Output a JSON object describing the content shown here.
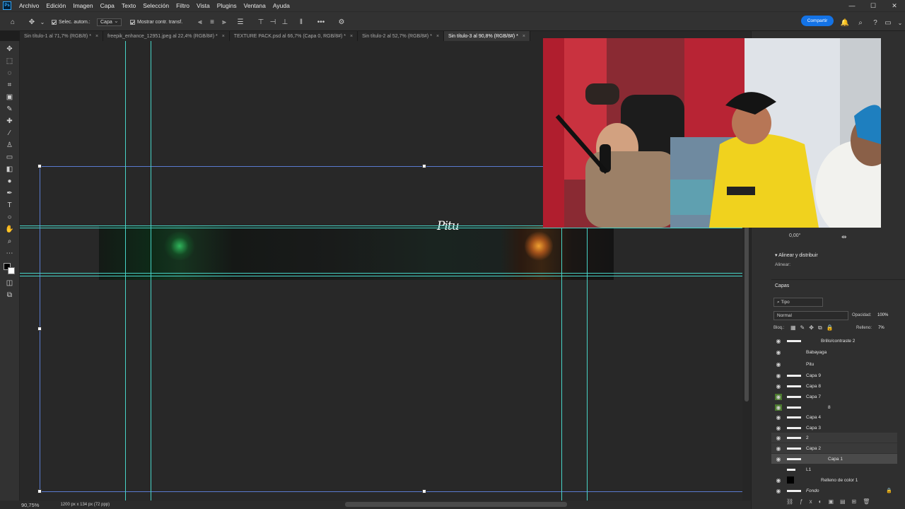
{
  "app": {
    "logo": "Ps"
  },
  "menu": [
    "Archivo",
    "Edición",
    "Imagen",
    "Capa",
    "Texto",
    "Selección",
    "Filtro",
    "Vista",
    "Plugins",
    "Ventana",
    "Ayuda"
  ],
  "window_controls": [
    "—",
    "☐",
    "✕"
  ],
  "options_bar": {
    "auto_select_label": "Selec. autom.:",
    "auto_select_value": "Capa",
    "show_transform_label": "Mostrar contr. transf.",
    "more_label": "•••",
    "share_label": "Compartir"
  },
  "tabs": [
    {
      "label": "Sin título-1 al 71,7% (RGB/8) *"
    },
    {
      "label": "freepik_enhance_12951.jpeg al 22,4% (RGB/8#) *"
    },
    {
      "label": "TEXTURE PACK.psd al 66,7% (Capa 0, RGB/8#) *"
    },
    {
      "label": "Sin título-2 al 52,7% (RGB/8#) *"
    },
    {
      "label": "Sin título-3 al 90,8% (RGB/8#) *"
    }
  ],
  "tab_close": "×",
  "canvas": {
    "text_layer": "Pitu"
  },
  "status": {
    "zoom": "90,75%",
    "doc_info": "1200 px x 134 px (72 ppp)"
  },
  "properties": {
    "angle": "0,00°"
  },
  "align_panel": {
    "title": "Alinear y distribuir",
    "label": "Alinear:"
  },
  "layers_panel": {
    "title": "Capas",
    "filter": "Tipo",
    "blend_mode": "Normal",
    "opacity_label": "Opacidad:",
    "opacity_value": "100%",
    "lock_label": "Bloq.:",
    "fill_label": "Relleno:",
    "fill_value": "7%",
    "layers": [
      {
        "name": "Brillo/contraste 2",
        "visible": true
      },
      {
        "name": "Babayaga",
        "visible": true
      },
      {
        "name": "Pitu",
        "visible": true
      },
      {
        "name": "Capa 9",
        "visible": true
      },
      {
        "name": "Capa 8",
        "visible": true
      },
      {
        "name": "Capa 7",
        "visible": true
      },
      {
        "name": "8",
        "visible": true
      },
      {
        "name": "Capa 4",
        "visible": true
      },
      {
        "name": "Capa 3",
        "visible": true
      },
      {
        "name": "2",
        "visible": true
      },
      {
        "name": "Capa 2",
        "visible": true
      },
      {
        "name": "Capa 1",
        "visible": true
      },
      {
        "name": "L1",
        "visible": false
      },
      {
        "name": "Relleno de color 1",
        "visible": true
      },
      {
        "name": "Fondo",
        "visible": true
      }
    ]
  },
  "colors": {
    "accent": "#1473e6",
    "guide": "#47d4c7",
    "selection": "#5a7bd0",
    "highlight_eye": "#4b7a2d"
  }
}
